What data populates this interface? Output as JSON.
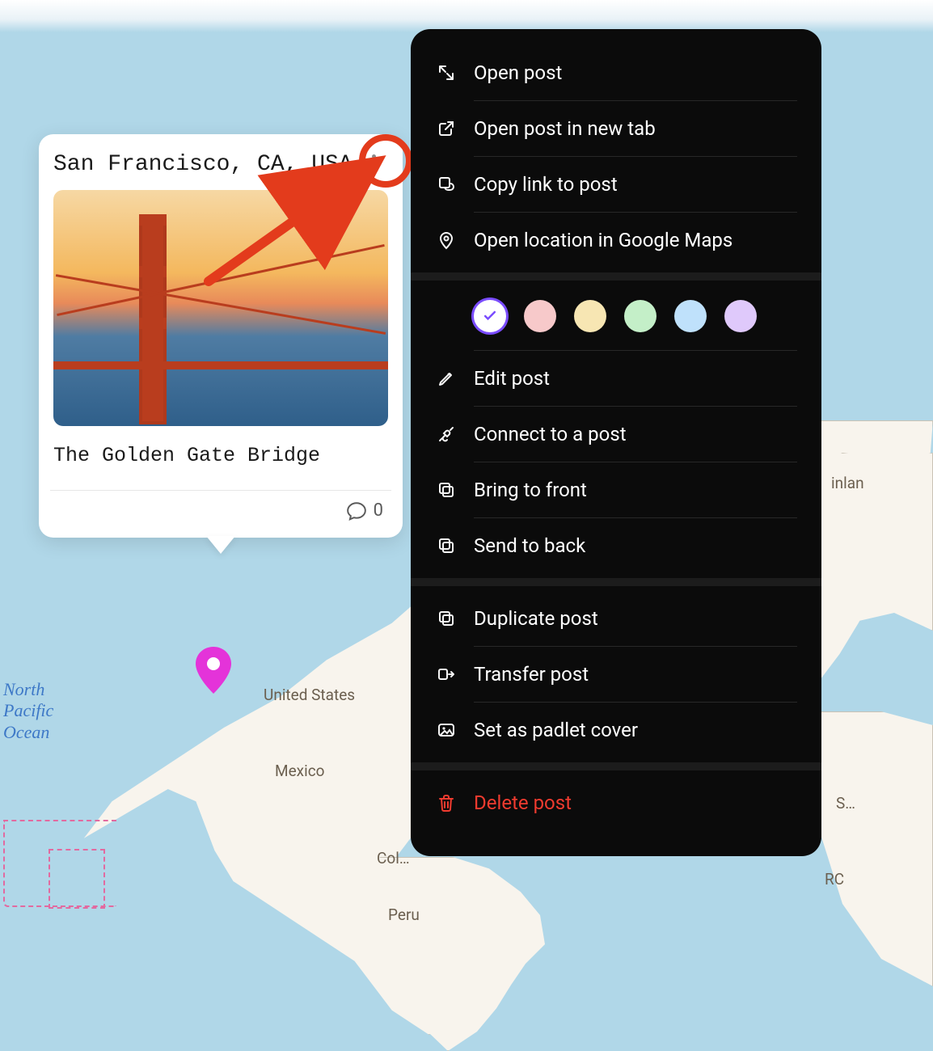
{
  "card": {
    "title": "San Francisco, CA, USA",
    "caption": "The Golden Gate Bridge",
    "comment_count": "0"
  },
  "map_labels": {
    "ocean": "North\nPacific\nOcean",
    "usa": "United States",
    "mexico": "Mexico",
    "colombia": "Col…",
    "peru": "Peru",
    "inland": "inlan",
    "rc": "RC",
    "sc": "S…"
  },
  "menu": {
    "open_post": "Open post",
    "open_new_tab": "Open post in new tab",
    "copy_link": "Copy link to post",
    "open_maps": "Open location in Google Maps",
    "edit_post": "Edit post",
    "connect": "Connect to a post",
    "bring_front": "Bring to front",
    "send_back": "Send to back",
    "duplicate": "Duplicate post",
    "transfer": "Transfer post",
    "set_cover": "Set as padlet cover",
    "delete": "Delete post"
  },
  "colors": {
    "swatches": [
      "#ffffff",
      "#f7c9ca",
      "#f7e6b3",
      "#c4efc8",
      "#bfe1fb",
      "#dfc9fb"
    ],
    "selected_index": 0
  }
}
